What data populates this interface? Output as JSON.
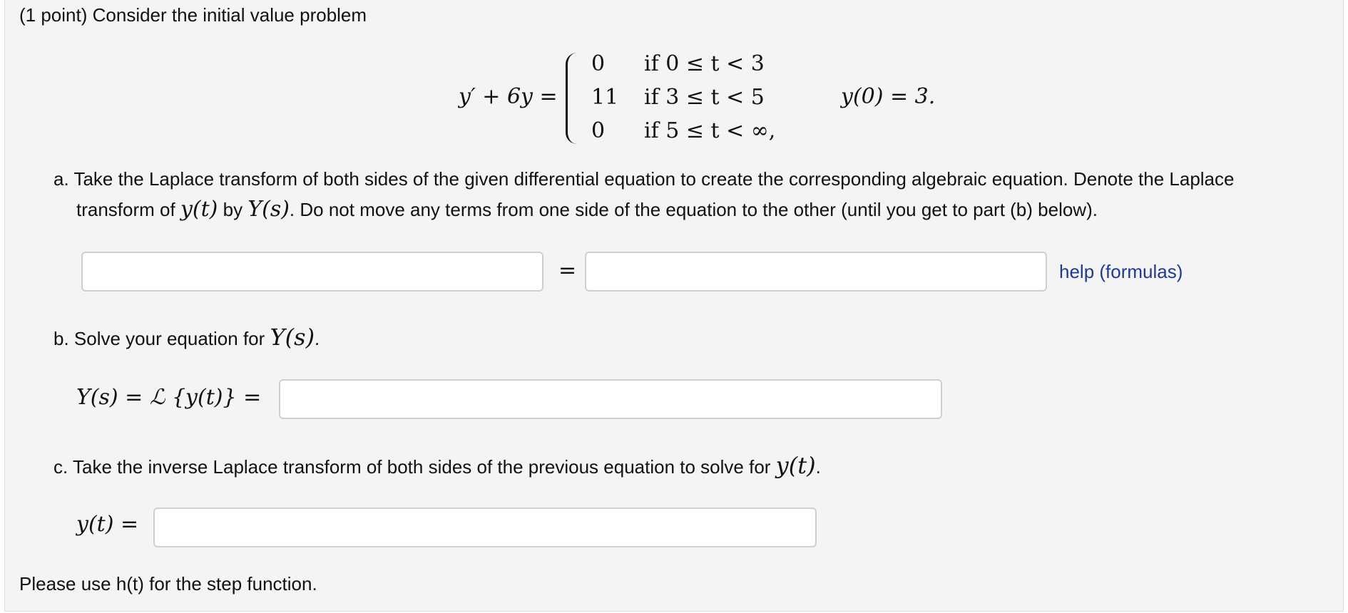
{
  "problem": {
    "points_label": "(1 point)",
    "intro": "Consider the initial value problem",
    "equation": {
      "lhs": "y′ + 6y =",
      "pieces": [
        {
          "value": "0",
          "condition": "if 0 ≤ t < 3"
        },
        {
          "value": "11",
          "condition": "if 3 ≤ t < 5"
        },
        {
          "value": "0",
          "condition": "if 5 ≤ t < ∞,"
        }
      ],
      "initial_condition": "y(0) = 3."
    }
  },
  "part_a": {
    "line1": "a. Take the Laplace transform of both sides of the given differential equation to create the corresponding algebraic equation. Denote the Laplace",
    "line2_pre": "transform of",
    "line2_y": "y(t)",
    "line2_mid": "by",
    "line2_Y": "Y(s)",
    "line2_post": ". Do not move any terms from one side of the equation to the other (until you get to part (b) below).",
    "equals": "=",
    "left_value": "",
    "right_value": "",
    "help_link": "help (formulas)"
  },
  "part_b": {
    "prompt": "b. Solve your equation for",
    "prompt_Y": "Y(s)",
    "prompt_end": ".",
    "label": "Y(s) = ℒ {y(t)} =",
    "value": ""
  },
  "part_c": {
    "prompt": "c. Take the inverse Laplace transform of both sides of the previous equation to solve for",
    "prompt_y": "y(t)",
    "prompt_end": ".",
    "label": "y(t) =",
    "value": ""
  },
  "note": "Please use h(t) for the step function.",
  "colors": {
    "panel_bg": "#f4f4f4",
    "link": "#1f3a93",
    "input_border": "#cfcfcf"
  }
}
